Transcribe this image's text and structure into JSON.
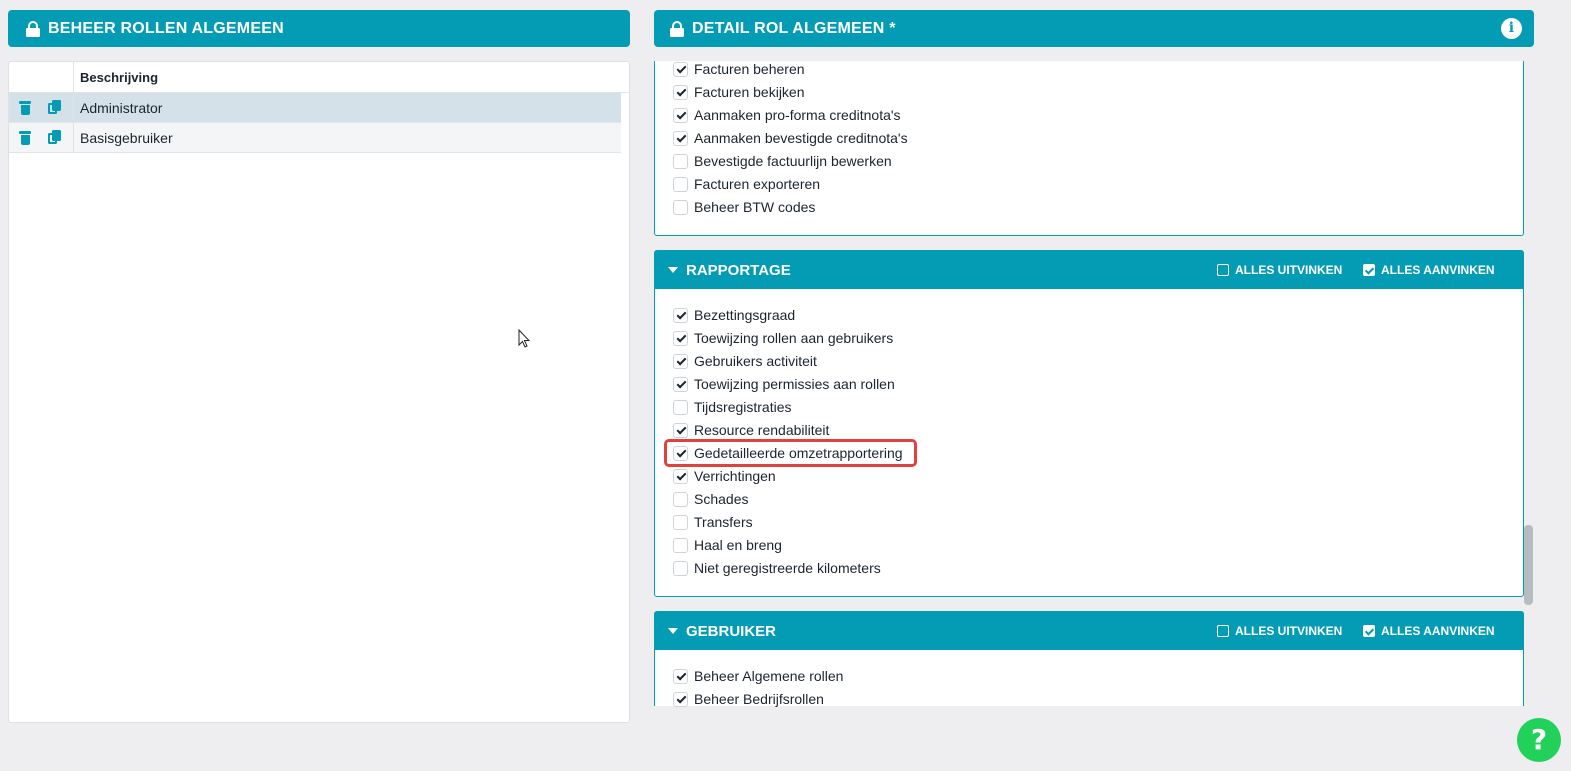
{
  "left_panel": {
    "title": "BEHEER ROLLEN ALGEMEEN",
    "column_header": "Beschrijving",
    "rows": [
      {
        "label": "Administrator"
      },
      {
        "label": "Basisgebruiker"
      }
    ]
  },
  "right_panel": {
    "title": "DETAIL ROL ALGEMEEN *",
    "facturen_items": [
      {
        "label": "Facturen beheren",
        "checked": true
      },
      {
        "label": "Facturen bekijken",
        "checked": true
      },
      {
        "label": "Aanmaken pro-forma creditnota's",
        "checked": true
      },
      {
        "label": "Aanmaken bevestigde creditnota's",
        "checked": true
      },
      {
        "label": "Bevestigde factuurlijn bewerken",
        "checked": false
      },
      {
        "label": "Facturen exporteren",
        "checked": false
      },
      {
        "label": "Beheer BTW codes",
        "checked": false
      }
    ],
    "rapportage": {
      "title": "RAPPORTAGE",
      "uncheck_all": "ALLES UITVINKEN",
      "check_all": "ALLES AANVINKEN",
      "items": [
        {
          "label": "Bezettingsgraad",
          "checked": true
        },
        {
          "label": "Toewijzing rollen aan gebruikers",
          "checked": true
        },
        {
          "label": "Gebruikers activiteit",
          "checked": true
        },
        {
          "label": "Toewijzing permissies aan rollen",
          "checked": true
        },
        {
          "label": "Tijdsregistraties",
          "checked": false
        },
        {
          "label": "Resource rendabiliteit",
          "checked": true
        },
        {
          "label": "Gedetailleerde omzetrapportering",
          "checked": true
        },
        {
          "label": "Verrichtingen",
          "checked": true
        },
        {
          "label": "Schades",
          "checked": false
        },
        {
          "label": "Transfers",
          "checked": false
        },
        {
          "label": "Haal en breng",
          "checked": false
        },
        {
          "label": "Niet geregistreerde kilometers",
          "checked": false
        }
      ]
    },
    "gebruiker": {
      "title": "GEBRUIKER",
      "uncheck_all": "ALLES UITVINKEN",
      "check_all": "ALLES AANVINKEN",
      "items": [
        {
          "label": "Beheer Algemene rollen",
          "checked": true
        },
        {
          "label": "Beheer Bedrijfsrollen",
          "checked": true
        }
      ]
    }
  },
  "help_button": {
    "label": "?"
  },
  "colors": {
    "accent": "#049cb4",
    "help": "#21d15a",
    "highlight": "#e0423f"
  }
}
